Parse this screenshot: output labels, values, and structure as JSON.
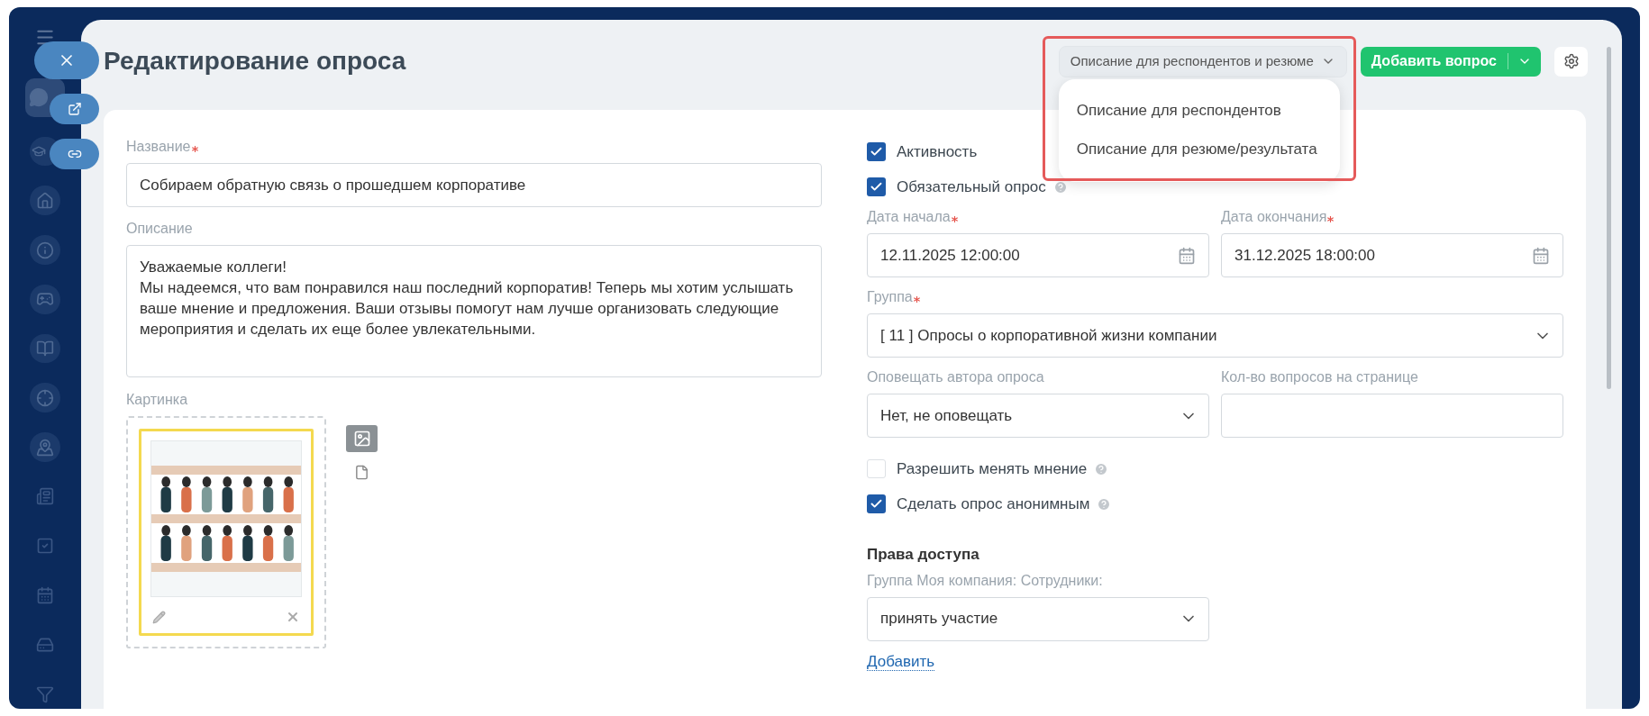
{
  "title": "Редактирование опроса",
  "description_mode": {
    "value": "Описание для респондентов и резюме",
    "expanded": true,
    "options": [
      {
        "label": "Описание для респондентов"
      },
      {
        "label": "Описание для резюме/результата"
      }
    ]
  },
  "add_question_button": "Добавить вопрос",
  "left": {
    "name": {
      "kind": "text",
      "label": "Название",
      "required": true,
      "value": "Собираем обратную связь о прошедшем корпоративе"
    },
    "description": {
      "kind": "textarea",
      "label": "Описание",
      "required": false,
      "value": "Уважаемые коллеги!\nМы надеемся, что вам понравился наш последний корпоратив! Теперь мы хотим услышать ваше мнение и предложения. Ваши отзывы помогут нам лучше организовать следующие мероприятия и сделать их еще более увлекательными."
    },
    "picture": {
      "label": "Картинка"
    }
  },
  "right": {
    "checks_top": [
      {
        "label": "Активность",
        "checked": true,
        "help": false
      },
      {
        "label": "Обязательный опрос",
        "checked": true,
        "help": true
      }
    ],
    "start_date": {
      "kind": "date",
      "label": "Дата начала",
      "required": true,
      "value": "12.11.2025 12:00:00"
    },
    "end_date": {
      "kind": "date",
      "label": "Дата окончания",
      "required": true,
      "value": "31.12.2025 18:00:00"
    },
    "group": {
      "kind": "select",
      "label": "Группа",
      "required": true,
      "value": "[ 11 ] Опросы о корпоративной жизни компании"
    },
    "notify_author": {
      "kind": "select",
      "label": "Оповещать автора опроса",
      "required": false,
      "value": "Нет, не оповещать"
    },
    "questions_per_page": {
      "kind": "text",
      "label": "Кол-во вопросов на странице",
      "required": false
    },
    "checks_bottom": [
      {
        "label": "Разрешить менять мнение",
        "checked": false,
        "help": true
      },
      {
        "label": "Сделать опрос анонимным",
        "checked": true,
        "help": true
      }
    ],
    "access": {
      "title": "Права доступа",
      "field": {
        "kind": "select",
        "label": "Группа Моя компания: Сотрудники:",
        "required": false,
        "value": "принять участие"
      },
      "add_link": "Добавить"
    }
  }
}
